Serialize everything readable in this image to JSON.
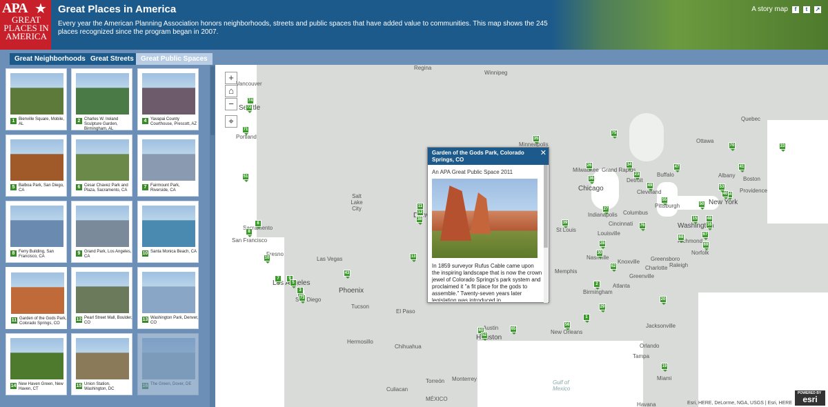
{
  "header": {
    "logo_top": "APA",
    "logo_sub": "GREAT PLACES IN AMERICA",
    "title": "Great Places in America",
    "description": "Every year the American Planning Association honors neighborhoods, streets and public spaces that have added value to communities. This map shows the 245 places recognized since the program began in 2007.",
    "story_map_label": "A story map",
    "social": [
      "f",
      "t",
      "↗"
    ]
  },
  "tabs": [
    {
      "label": "Great Neighborhoods",
      "active": false
    },
    {
      "label": "Great Streets",
      "active": false
    },
    {
      "label": "Great Public Spaces",
      "active": true
    }
  ],
  "cards": [
    {
      "num": "1",
      "caption": "Bienville Square, Mobile, AL"
    },
    {
      "num": "2",
      "caption": "Charles W. Ireland Sculpture Garden, Birmingham, AL"
    },
    {
      "num": "4",
      "caption": "Yavapai County Courthouse, Prescott, AZ"
    },
    {
      "num": "5",
      "caption": "Balboa Park, San Diego, CA"
    },
    {
      "num": "6",
      "caption": "Cesar Chavez Park and Plaza, Sacramento, CA"
    },
    {
      "num": "7",
      "caption": "Fairmount Park, Riverside, CA"
    },
    {
      "num": "8",
      "caption": "Ferry Building, San Francisco, CA"
    },
    {
      "num": "9",
      "caption": "Grand Park, Los Angeles, CA"
    },
    {
      "num": "10",
      "caption": "Santa Monica Beach, CA"
    },
    {
      "num": "11",
      "caption": "Garden of the Gods Park, Colorado Springs, CO"
    },
    {
      "num": "12",
      "caption": "Pearl Street Mall, Boulder, CO"
    },
    {
      "num": "13",
      "caption": "Washington Park, Denver, CO"
    },
    {
      "num": "14",
      "caption": "New Haven Green, New Haven, CT"
    },
    {
      "num": "15",
      "caption": "Union Station, Washington, DC"
    },
    {
      "num": "16",
      "caption": "The Green, Dover, DE"
    }
  ],
  "map": {
    "controls": {
      "zoom_in": "+",
      "home": "⌂",
      "zoom_out": "−",
      "locate": "⌖"
    },
    "cities": [
      "Regina",
      "Winnipeg",
      "Quebec",
      "Ottawa",
      "Minneapolis",
      "Milwaukee",
      "Grand Rapids",
      "Detroit",
      "Buffalo",
      "Albany",
      "Boston",
      "Providence",
      "New York",
      "Chicago",
      "Cleveland",
      "Pittsburgh",
      "Columbus",
      "Indianapolis",
      "Cincinnati",
      "Washington",
      "Richmond",
      "Norfolk",
      "St Louis",
      "Louisville",
      "Nashville",
      "Knoxville",
      "Greensboro",
      "Raleigh",
      "Charlotte",
      "Greenville",
      "Memphis",
      "Atlanta",
      "Birmingham",
      "Jacksonville",
      "New Orleans",
      "Orlando",
      "Tampa",
      "Miami",
      "Havana",
      "Houston",
      "Austin",
      "El Paso",
      "Tucson",
      "Phoenix",
      "Las Vegas",
      "Los Angeles",
      "San Diego",
      "Fresno",
      "Sacramento",
      "San Francisco",
      "Salt Lake City",
      "Denver",
      "Seattle",
      "Portland",
      "Vancouver",
      "Hermosillo",
      "Chihuahua",
      "Monterrey",
      "Culiacan",
      "Torreón",
      "Gulf of Mexico",
      "MÉXICO"
    ],
    "pins": [
      "74",
      "72",
      "71",
      "51",
      "6",
      "8",
      "10",
      "7",
      "9",
      "5",
      "4",
      "43",
      "13",
      "11",
      "12",
      "38",
      "35",
      "75",
      "26",
      "36",
      "34",
      "23",
      "49",
      "47",
      "41",
      "44",
      "40",
      "33",
      "70",
      "39",
      "27",
      "55",
      "50",
      "53",
      "48",
      "15",
      "16",
      "76",
      "68",
      "67",
      "69",
      "28",
      "30",
      "62",
      "2",
      "20",
      "29",
      "1",
      "56",
      "60",
      "65",
      "52",
      "19",
      "3",
      "73"
    ],
    "attribution": "Esri, HERE, DeLorme, NGA, USGS | Esri, HERE",
    "esri_powered": "POWERED BY",
    "esri_logo": "esri"
  },
  "popup": {
    "title": "Garden of the Gods Park, Colorado Springs, CO",
    "subtitle": "An APA Great Public Space 2011",
    "body": "In 1859 surveyor Rufus Cable came upon the inspiring landscape that is now the crown jewel of Colorado Springs's park system and proclaimed it \"a fit place for the gods to assemble.\" Twenty-seven years later legislation was introduced in",
    "close": "✕"
  },
  "colors": {
    "header": "#1d5a8c",
    "sidebar": "#6c8fb7",
    "pin": "#3c9a2c",
    "logo": "#c8202b"
  }
}
